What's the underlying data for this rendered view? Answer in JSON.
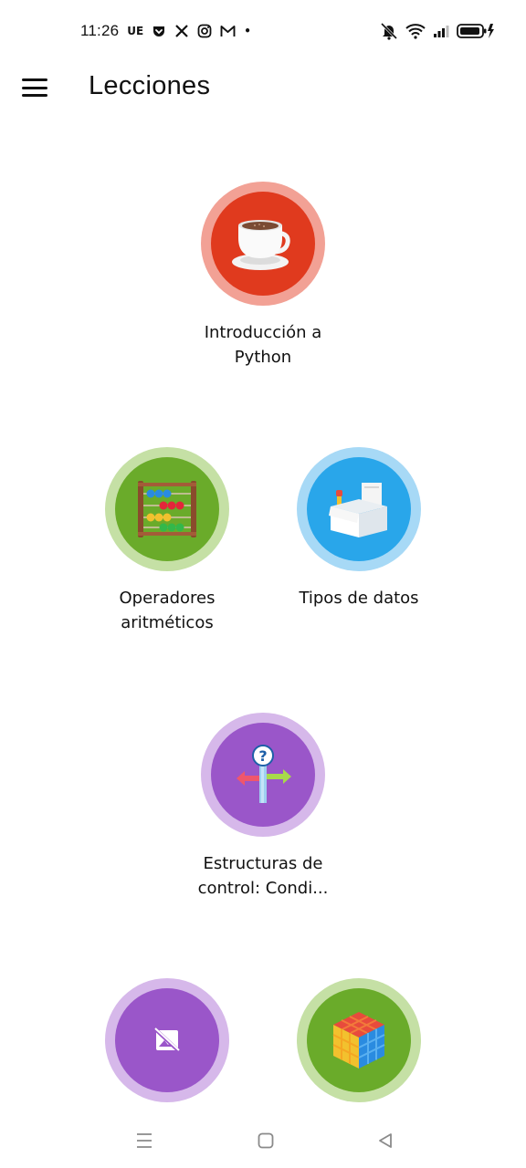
{
  "status_bar": {
    "time": "11:26",
    "notification_icons": [
      "ue-icon",
      "pocket-icon",
      "x-icon",
      "instagram-icon",
      "gmail-icon"
    ],
    "ue_text": "UE",
    "dot": "•"
  },
  "app_bar": {
    "title": "Lecciones",
    "menu_icon": "hamburger-menu-icon"
  },
  "lessons": [
    {
      "label": "Introducción a Python",
      "icon": "coffee-cup-icon",
      "color": "#e03a1e",
      "ring": "#f2a195"
    },
    {
      "label": "Operadores aritméticos",
      "icon": "abacus-icon",
      "color": "#6aab2a",
      "ring": "#c5e0a5"
    },
    {
      "label": "Tipos de datos",
      "icon": "box-icon",
      "color": "#29a6ea",
      "ring": "#a7d9f6"
    },
    {
      "label": "Estructuras de control: Condi...",
      "icon": "signpost-icon",
      "color": "#9a56c9",
      "ring": "#d6b8ea"
    },
    {
      "label": "",
      "icon": "broken-image-icon",
      "color": "#9a56c9",
      "ring": "#d6b8ea"
    },
    {
      "label": "",
      "icon": "rubiks-cube-icon",
      "color": "#6aab2a",
      "ring": "#c5e0a5"
    }
  ],
  "nav_bar": {
    "recents_icon": "recents-icon",
    "home_icon": "home-icon",
    "back_icon": "back-icon"
  }
}
